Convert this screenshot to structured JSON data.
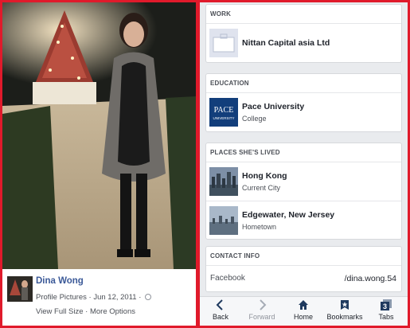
{
  "photo_viewer": {
    "owner_name": "Dina Wong",
    "album": "Profile Pictures",
    "date": "Jun 12, 2011",
    "separator": "·",
    "view_full_size": "View Full Size",
    "more_options": "More Options"
  },
  "profile": {
    "work": {
      "header": "WORK",
      "items": [
        {
          "title": "Nittan Capital asia Ltd"
        }
      ]
    },
    "education": {
      "header": "EDUCATION",
      "items": [
        {
          "title": "Pace University",
          "subtitle": "College",
          "logo_text": "PACE",
          "logo_sub": "UNIVERSITY"
        }
      ]
    },
    "places": {
      "header": "PLACES SHE'S LIVED",
      "items": [
        {
          "title": "Hong Kong",
          "subtitle": "Current City"
        },
        {
          "title": "Edgewater, New Jersey",
          "subtitle": "Hometown"
        }
      ]
    },
    "contact": {
      "header": "CONTACT INFO",
      "items": [
        {
          "label": "Facebook",
          "value": "/dina.wong.54"
        }
      ]
    }
  },
  "toolbar": {
    "items": [
      {
        "label": "Back",
        "icon": "chevron-left-icon"
      },
      {
        "label": "Forward",
        "icon": "chevron-right-icon"
      },
      {
        "label": "Home",
        "icon": "home-icon"
      },
      {
        "label": "Bookmarks",
        "icon": "bookmark-icon"
      },
      {
        "label": "Tabs",
        "icon": "tabs-icon",
        "badge": "3"
      }
    ]
  },
  "colors": {
    "frame_border": "#e01a2b",
    "link_blue": "#3b5998",
    "icon_navy": "#1f3a5f",
    "card_bg": "#ffffff",
    "page_bg": "#e9ebee"
  }
}
